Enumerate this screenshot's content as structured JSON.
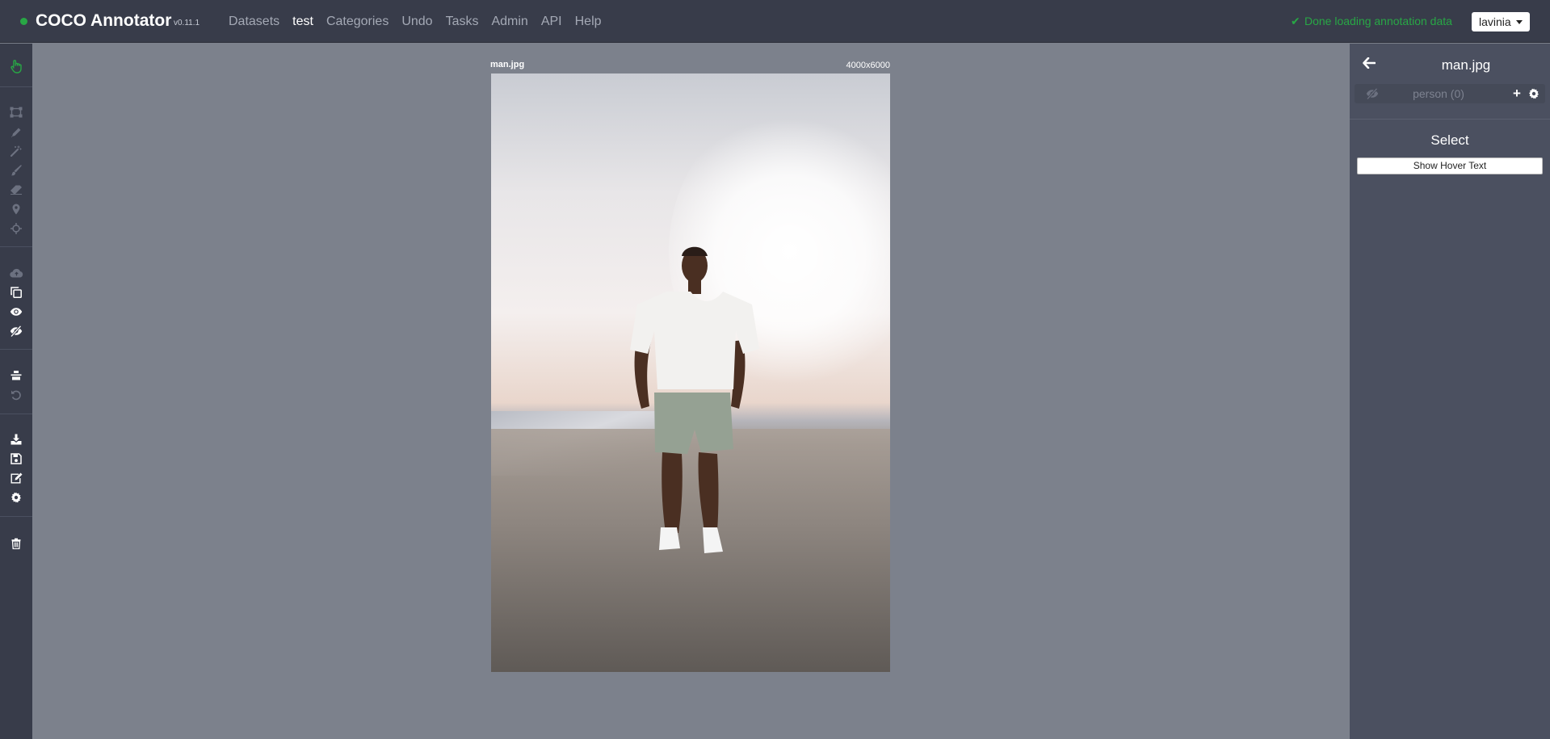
{
  "navbar": {
    "brand": "COCO Annotator",
    "version": "v0.11.1",
    "links": [
      "Datasets",
      "test",
      "Categories",
      "Undo",
      "Tasks",
      "Admin",
      "API",
      "Help"
    ],
    "active_link": "test",
    "status": "Done loading annotation data",
    "user": "lavinia"
  },
  "toolbar": {
    "tools": [
      "select-hand-icon",
      "bbox-icon",
      "polygon-pencil-icon",
      "magic-wand-icon",
      "brush-icon",
      "eraser-icon",
      "keypoint-icon",
      "dextr-crosshair-icon",
      "cloud-icon",
      "copy-annotations-icon",
      "show-all-eye-icon",
      "hide-all-eye-icon",
      "center-image-icon",
      "undo-icon",
      "download-icon",
      "save-icon",
      "edit-metadata-icon",
      "settings-icon",
      "delete-image-icon"
    ],
    "accent_color": "#28a745"
  },
  "canvas": {
    "file_name": "man.jpg",
    "dimensions": "4000x6000"
  },
  "right_panel": {
    "title": "man.jpg",
    "category_label": "person (0)",
    "tool_panel_title": "Select",
    "hover_button": "Show Hover Text"
  }
}
